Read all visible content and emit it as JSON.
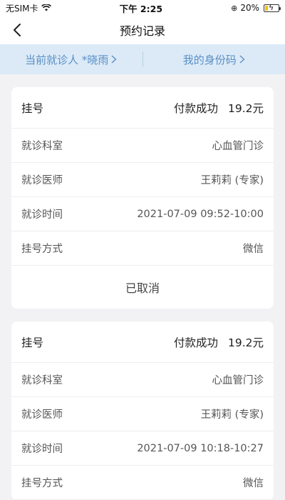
{
  "status_bar": {
    "carrier": "无SIM卡",
    "time": "下午 2:25",
    "battery": "20%"
  },
  "nav": {
    "title": "预约记录"
  },
  "patient_bar": {
    "current_patient": "当前就诊人 *晓雨",
    "my_id_code": "我的身份码"
  },
  "cards": [
    {
      "type": "挂号",
      "status": "付款成功",
      "amount": "19.2元",
      "rows": [
        {
          "label": "就诊科室",
          "value": "心血管门诊"
        },
        {
          "label": "就诊医师",
          "value": "王莉莉 (专家)"
        },
        {
          "label": "就诊时间",
          "value": "2021-07-09 09:52-10:00"
        },
        {
          "label": "挂号方式",
          "value": "微信"
        }
      ],
      "footer": "已取消"
    },
    {
      "type": "挂号",
      "status": "付款成功",
      "amount": "19.2元",
      "rows": [
        {
          "label": "就诊科室",
          "value": "心血管门诊"
        },
        {
          "label": "就诊医师",
          "value": "王莉莉 (专家)"
        },
        {
          "label": "就诊时间",
          "value": "2021-07-09 10:18-10:27"
        },
        {
          "label": "挂号方式",
          "value": "微信"
        }
      ]
    }
  ]
}
